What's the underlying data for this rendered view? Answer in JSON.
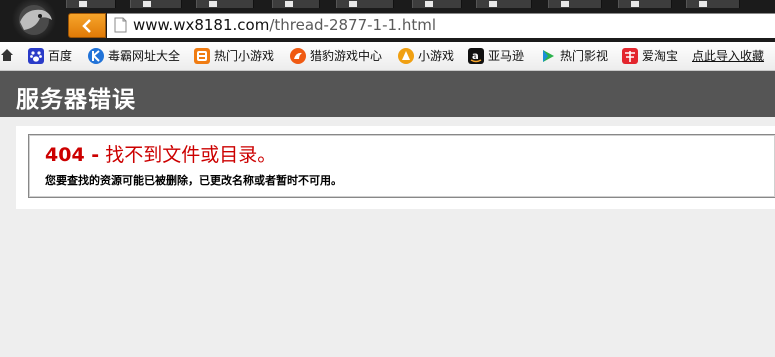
{
  "browser": {
    "address_url_host": "www.wx8181.com",
    "address_url_path": "/thread-2877-1-1.html"
  },
  "bookmarks": [
    {
      "label": "百度",
      "icon": "baidu-paw-icon",
      "color": "#2a3bc8"
    },
    {
      "label": "毒霸网址大全",
      "icon": "duba-k-icon",
      "color": "#2173d8"
    },
    {
      "label": "热门小游戏",
      "icon": "game-icon",
      "color": "#f07c12"
    },
    {
      "label": "猎豹游戏中心",
      "icon": "cheetah-game-icon",
      "color": "#f05a12"
    },
    {
      "label": "小游戏",
      "icon": "mini-game-icon",
      "color": "#f0a012"
    },
    {
      "label": "亚马逊",
      "icon": "amazon-icon",
      "color": "#111111"
    },
    {
      "label": "热门影视",
      "icon": "video-play-icon",
      "color": "#2bb24c"
    },
    {
      "label": "爱淘宝",
      "icon": "taobao-icon",
      "color": "#e3262e"
    },
    {
      "label": "点此导入收藏",
      "icon": "",
      "color": ""
    }
  ],
  "page": {
    "title": "服务器错误",
    "error_code": "404 -",
    "error_heading": "找不到文件或目录。",
    "error_message": "您要查找的资源可能已被删除，已更改名称或者暂时不可用。"
  },
  "colors": {
    "header_bg": "#555555",
    "error_red": "#cc0000",
    "back_button": "#f0901a"
  }
}
